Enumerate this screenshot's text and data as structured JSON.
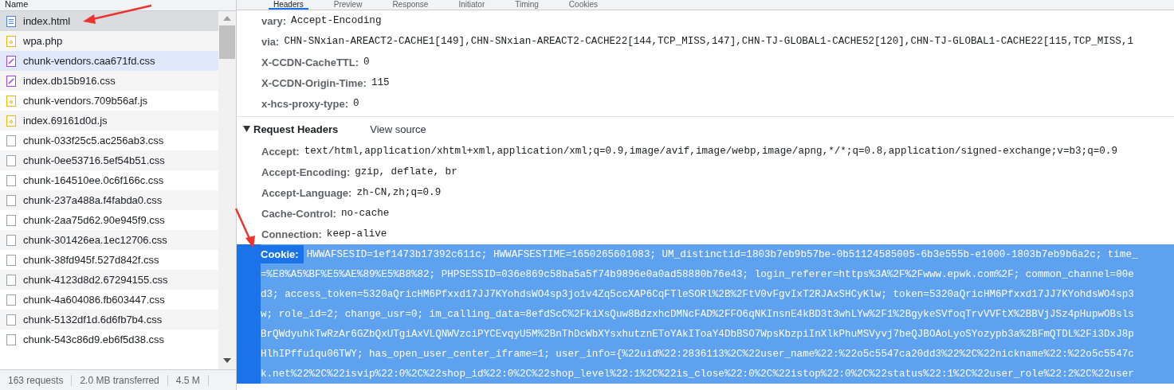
{
  "requests_panel": {
    "column_header": "Name",
    "rows": [
      {
        "name": "index.html",
        "kind": "document",
        "selected": true,
        "hovered": false
      },
      {
        "name": "wpa.php",
        "kind": "script",
        "selected": false,
        "hovered": false
      },
      {
        "name": "chunk-vendors.caa671fd.css",
        "kind": "stylesheet",
        "selected": false,
        "hovered": true
      },
      {
        "name": "index.db15b916.css",
        "kind": "stylesheet",
        "selected": false,
        "hovered": false
      },
      {
        "name": "chunk-vendors.709b56af.js",
        "kind": "script",
        "selected": false,
        "hovered": false
      },
      {
        "name": "index.69161d0d.js",
        "kind": "script",
        "selected": false,
        "hovered": false
      },
      {
        "name": "chunk-033f25c5.ac256ab3.css",
        "kind": "other",
        "selected": false,
        "hovered": false
      },
      {
        "name": "chunk-0ee53716.5ef54b51.css",
        "kind": "other",
        "selected": false,
        "hovered": false
      },
      {
        "name": "chunk-164510ee.0c6f166c.css",
        "kind": "other",
        "selected": false,
        "hovered": false
      },
      {
        "name": "chunk-237a488a.f4fabda0.css",
        "kind": "other",
        "selected": false,
        "hovered": false
      },
      {
        "name": "chunk-2aa75d62.90e945f9.css",
        "kind": "other",
        "selected": false,
        "hovered": false
      },
      {
        "name": "chunk-301426ea.1ec12706.css",
        "kind": "other",
        "selected": false,
        "hovered": false
      },
      {
        "name": "chunk-38fd945f.527d842f.css",
        "kind": "other",
        "selected": false,
        "hovered": false
      },
      {
        "name": "chunk-4123d8d2.67294155.css",
        "kind": "other",
        "selected": false,
        "hovered": false
      },
      {
        "name": "chunk-4a604086.fb603447.css",
        "kind": "other",
        "selected": false,
        "hovered": false
      },
      {
        "name": "chunk-5132df1d.6d6fb7b4.css",
        "kind": "other",
        "selected": false,
        "hovered": false
      },
      {
        "name": "chunk-543c86d9.eb6f5d38.css",
        "kind": "other",
        "selected": false,
        "hovered": false
      }
    ],
    "status_bar": [
      "163 requests",
      "2.0 MB transferred",
      "4.5 M"
    ]
  },
  "details": {
    "tabs": [
      {
        "label": "Headers",
        "selected": true
      },
      {
        "label": "Preview",
        "selected": false
      },
      {
        "label": "Response",
        "selected": false
      },
      {
        "label": "Initiator",
        "selected": false
      },
      {
        "label": "Timing",
        "selected": false
      },
      {
        "label": "Cookies",
        "selected": false
      }
    ],
    "response_headers": [
      {
        "name": "vary:",
        "value": "Accept-Encoding"
      },
      {
        "name": "via:",
        "value": "CHN-SNxian-AREACT2-CACHE1[149],CHN-SNxian-AREACT2-CACHE22[144,TCP_MISS,147],CHN-TJ-GLOBAL1-CACHE52[120],CHN-TJ-GLOBAL1-CACHE22[115,TCP_MISS,1"
      },
      {
        "name": "X-CCDN-CacheTTL:",
        "value": "0"
      },
      {
        "name": "X-CCDN-Origin-Time:",
        "value": "115"
      },
      {
        "name": "x-hcs-proxy-type:",
        "value": "0"
      }
    ],
    "request_section": {
      "title": "Request Headers",
      "expanded": true,
      "link": "View source"
    },
    "request_headers": [
      {
        "name": "Accept:",
        "value": "text/html,application/xhtml+xml,application/xml;q=0.9,image/avif,image/webp,image/apng,*/*;q=0.8,application/signed-exchange;v=b3;q=0.9"
      },
      {
        "name": "Accept-Encoding:",
        "value": "gzip, deflate, br"
      },
      {
        "name": "Accept-Language:",
        "value": "zh-CN,zh;q=0.9"
      },
      {
        "name": "Cache-Control:",
        "value": "no-cache"
      },
      {
        "name": "Connection:",
        "value": "keep-alive"
      }
    ],
    "cookie": {
      "name": "Cookie:",
      "selected": true,
      "lines": [
        "HWWAFSESID=1ef1473b17392c611c; HWWAFSESTIME=1650265601083; UM_distinctid=1803b7eb9b57be-0b51124585005-6b3e555b-e1000-1803b7eb9b6a2c; time_",
        "=%E8%A5%BF%E5%AE%89%E5%B8%82; PHPSESSID=036e869c58ba5a5f74b9896e0a0ad58880b76e43; login_referer=https%3A%2F%2Fwww.epwk.com%2F; common_channel=00e",
        "d3; access_token=5320aQricHM6Pfxxd17JJ7KYohdsWO4sp3jo1v4Zq5ccXAP6CqFTleSORl%2B%2FtV0vFgvIxT2RJAxSHCyKlw; token=5320aQricHM6Pfxxd17JJ7KYohdsWO4sp3",
        "w; role_id=2; change_usr=0; im_calling_data=8efdScC%2FkiXsQuw8BdzxhcDMNcFAD%2FFO6qNKInsnE4kBD3t3whLYw%2F1%2BgykeSVfoqTrvVVFtX%2BBVjJSz4pHupwOBsls",
        "BrQWdyuhkTwRzAr6GZbQxUTgiAxVLQNWVzciPYCEvqyU5M%2BnThDcWbXYsxhutznEToYAkIToaY4DbBSO7WpsKbzpiInXlkPhuMSVyvj7beQJBOAoLyoSYozypb3a%2BFmQTDL%2Fi3DxJ8p",
        "HlhIPffu1qu06TWY; has_open_user_center_iframe=1; user_info={%22uid%22:2836113%2C%22user_name%22:%22o5c5547ca20dd3%22%2C%22nickname%22:%22o5c5547c",
        "k.net%22%2C%22isvip%22:0%2C%22shop_id%22:0%2C%22shop_level%22:1%2C%22is_close%22:0%2C%22istop%22:0%2C%22status%22:1%2C%22user_role%22:2%2C%22user"
      ]
    }
  }
}
